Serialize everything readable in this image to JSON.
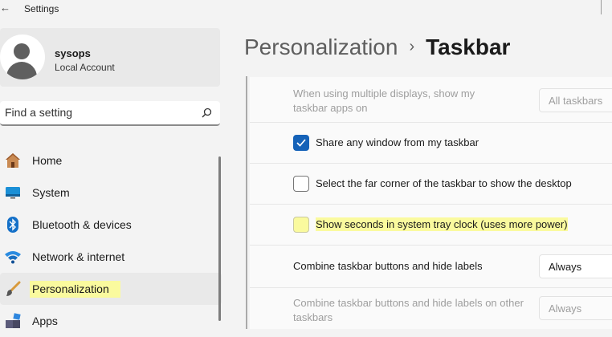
{
  "app": {
    "title": "Settings",
    "back_glyph": "←"
  },
  "profile": {
    "name": "sysops",
    "account_type": "Local Account"
  },
  "search": {
    "placeholder": "Find a setting",
    "icon": "search-icon"
  },
  "sidebar": {
    "items": [
      {
        "label": "Home",
        "icon": "home-icon"
      },
      {
        "label": "System",
        "icon": "system-icon"
      },
      {
        "label": "Bluetooth & devices",
        "icon": "bluetooth-icon"
      },
      {
        "label": "Network & internet",
        "icon": "wifi-icon"
      },
      {
        "label": "Personalization",
        "icon": "brush-icon",
        "selected": true,
        "highlighted": true
      },
      {
        "label": "Apps",
        "icon": "apps-icon"
      }
    ]
  },
  "breadcrumb": {
    "parent": "Personalization",
    "separator": "›",
    "current": "Taskbar"
  },
  "settings": {
    "multi_display": {
      "label": "When using multiple displays, show my taskbar apps on",
      "value": "All taskbars",
      "enabled": false
    },
    "share_window": {
      "label": "Share any window from my taskbar",
      "checked": true
    },
    "far_corner": {
      "label": "Select the far corner of the taskbar to show the desktop",
      "checked": false
    },
    "show_seconds": {
      "label": "Show seconds in system tray clock (uses more power)",
      "checked": false,
      "highlighted": true
    },
    "combine_buttons": {
      "label": "Combine taskbar buttons and hide labels",
      "value": "Always",
      "enabled": true
    },
    "combine_other": {
      "label": "Combine taskbar buttons and hide labels on other taskbars",
      "value": "Always",
      "enabled": false
    }
  },
  "colors": {
    "accent": "#1562b8",
    "highlight": "#fafa9e",
    "background": "#f3f3f3"
  }
}
